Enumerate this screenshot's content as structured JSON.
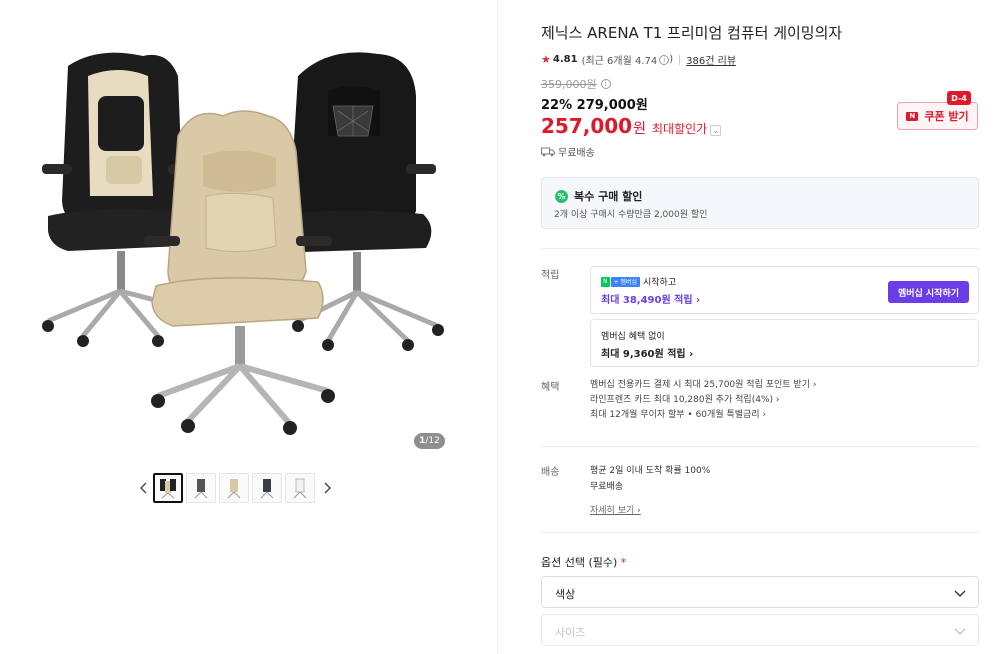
{
  "gallery": {
    "counter_current": "1",
    "counter_total": "/12",
    "prev_arrow": "‹",
    "next_arrow": "›"
  },
  "product": {
    "title": "제닉스 ARENA T1 프리미엄 컴퓨터 게이밍의자",
    "rating": "4.81",
    "recent_rating": "(최근 6개월 4.74",
    "recent_rating_close": ")",
    "review_count": "386건 리뷰",
    "original_price": "359,000원",
    "discount_line": "22% 279,000원",
    "final_price": "257,000",
    "final_won": "원",
    "final_label": "최대할인가",
    "coupon_label": "쿠폰 받기",
    "coupon_dday": "D-4",
    "free_shipping": "무료배송"
  },
  "multi_discount": {
    "title": "복수 구매 할인",
    "desc": "2개 이상 구매시 수량만큼 2,000원 할인"
  },
  "earn": {
    "label": "적립",
    "membership_badge_n": "N",
    "membership_badge_plus": "+ 멤버십",
    "card1_top": "시작하고",
    "card1_amount": "최대 38,490원 적립 ›",
    "card1_button": "멤버십 시작하기",
    "card2_top": "멤버십 혜택 없이",
    "card2_amount": "최대 9,360원 적립 ›"
  },
  "benefits": {
    "label": "혜택",
    "items": [
      "멤버십 전용카드 결제 시 최대 25,700원 적립 포인트 받기 ›",
      "라인프렌즈 카드 최대 10,280원 추가 적립(4%) ›",
      "최대 12개월 무이자 할부 • 60개월 특별금리 ›"
    ]
  },
  "shipping": {
    "label": "배송",
    "line1": "평균 2일 이내 도착 확률 100%",
    "line2": "무료배송",
    "detail_link": "자세히 보기 ›"
  },
  "options": {
    "title": "옵션 선택 (필수)",
    "required_mark": "*",
    "select1": "색상",
    "select2": "사이즈"
  },
  "colors": {
    "accent_red": "#e0182b",
    "membership_purple": "#6a3de8",
    "green": "#23c469"
  }
}
